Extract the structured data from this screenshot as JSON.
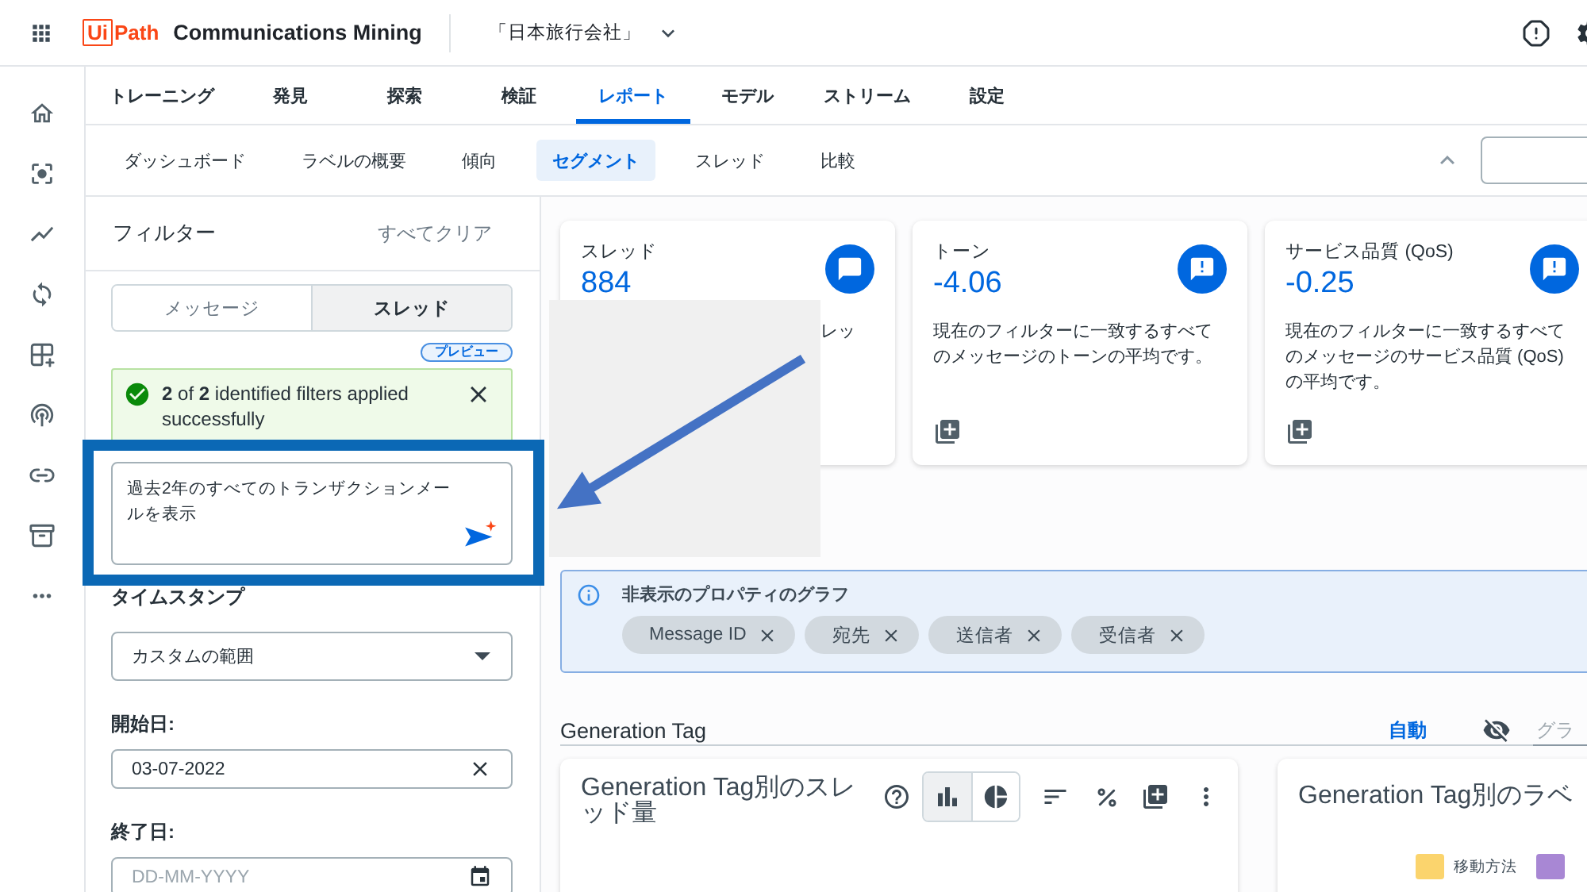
{
  "header": {
    "logo": {
      "boxed": "Ui",
      "text": "Path"
    },
    "product": "Communications Mining",
    "project": "「日本旅行会社」"
  },
  "tabs": [
    {
      "label": "トレーニング",
      "selected": false
    },
    {
      "label": "発見",
      "selected": false
    },
    {
      "label": "探索",
      "selected": false
    },
    {
      "label": "検証",
      "selected": false
    },
    {
      "label": "レポート",
      "selected": true
    },
    {
      "label": "モデル",
      "selected": false
    },
    {
      "label": "ストリーム",
      "selected": false
    },
    {
      "label": "設定",
      "selected": false
    }
  ],
  "subtabs": [
    {
      "label": "ダッシュボード",
      "selected": false
    },
    {
      "label": "ラベルの概要",
      "selected": false
    },
    {
      "label": "傾向",
      "selected": false
    },
    {
      "label": "セグメント",
      "selected": true
    },
    {
      "label": "スレッド",
      "selected": false
    },
    {
      "label": "比較",
      "selected": false
    }
  ],
  "filters": {
    "title": "フィルター",
    "clear": "すべてクリア",
    "modes": [
      {
        "label": "メッセージ",
        "selected": false
      },
      {
        "label": "スレッド",
        "selected": true
      }
    ],
    "badge": "プレビュー",
    "alert": "**2** of **2** identified filters applied successfully",
    "prompt": "過去2年のすべてのトランザクションメールを表示",
    "fields": [
      {
        "kind": "select",
        "label": "タイムスタンプ",
        "value": "カスタムの範囲"
      },
      {
        "kind": "date",
        "label": "開始日:",
        "value": "03-07-2022"
      },
      {
        "kind": "date",
        "label": "終了日:",
        "placeholder": "DD-MM-YYYY"
      }
    ]
  },
  "metrics": [
    {
      "kind": "count",
      "label": "スレッド",
      "value": "884",
      "description": "レッ",
      "covered": true
    },
    {
      "kind": "average",
      "label": "トーン",
      "value": "-4.06",
      "description": "現在のフィルターに一致するすべてのメッセージのトーンの平均です。",
      "covered": false
    },
    {
      "kind": "average",
      "label": "サービス品質 (QoS)",
      "value": "-0.25",
      "description": "現在のフィルターに一致するすべてのメッセージのサービス品質 (QoS)の平均です。",
      "covered": false
    }
  ],
  "hidden_properties": {
    "title": "非表示のプロパティのグラフ",
    "chips": [
      "Message ID",
      "宛先",
      "送信者",
      "受信者"
    ]
  },
  "section": {
    "title": "Generation Tag",
    "mode": "自動",
    "filter_placeholder": "グラ"
  },
  "charts": [
    {
      "title": "Generation Tag別のスレッド量",
      "views": [
        {
          "kind": "bar",
          "selected": true
        },
        {
          "kind": "pie",
          "selected": false
        }
      ]
    },
    {
      "title": "Generation Tag別のラベ",
      "legend": [
        {
          "label": "移動方法",
          "color": "#fbd46d"
        },
        {
          "color": "#a887d4"
        }
      ]
    }
  ]
}
